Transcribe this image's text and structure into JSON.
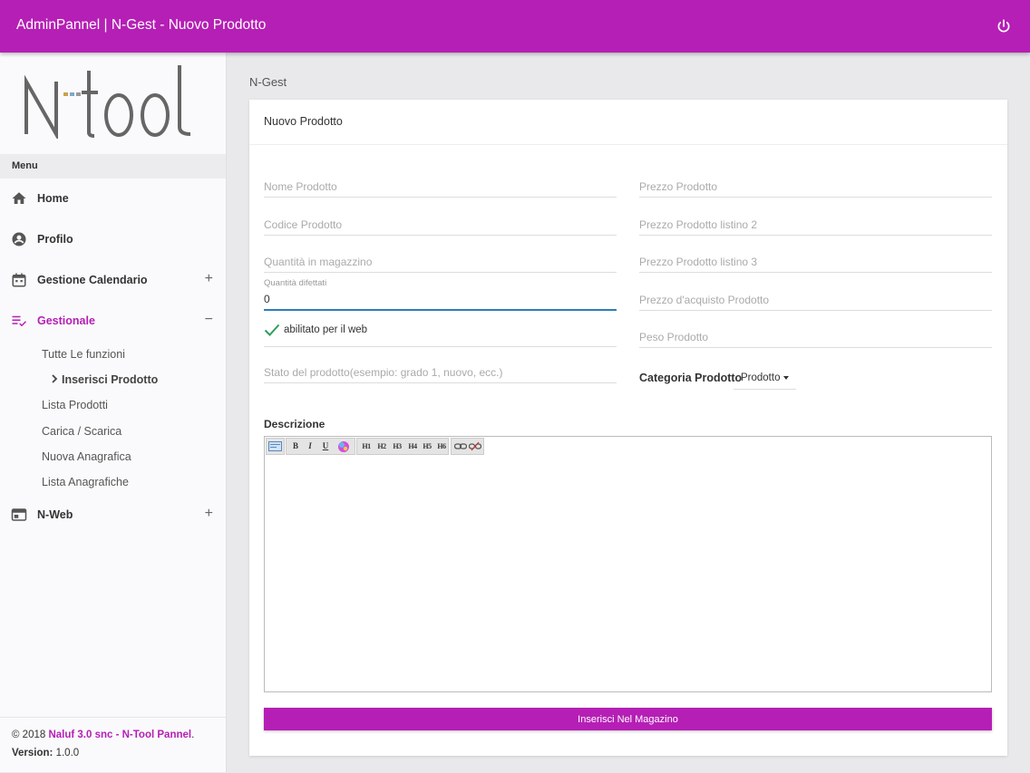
{
  "header": {
    "title": "AdminPannel | N-Gest - Nuovo Prodotto"
  },
  "sidebar": {
    "logo": "N·tool",
    "menu_label": "Menu",
    "items": [
      {
        "label": "Home",
        "icon": "home-icon"
      },
      {
        "label": "Profilo",
        "icon": "account-circle-icon"
      },
      {
        "label": "Gestione Calendario",
        "icon": "calendar-icon",
        "toggle": "+"
      },
      {
        "label": "Gestionale",
        "icon": "playlist-check-icon",
        "toggle": "−"
      },
      {
        "label": "N-Web",
        "icon": "web-window-icon",
        "toggle": "+"
      }
    ],
    "subitems": [
      "Tutte Le funzioni",
      "Inserisci Prodotto",
      "Lista Prodotti",
      "Carica / Scarica",
      "Nuova Anagrafica",
      "Lista Anagrafiche"
    ]
  },
  "footer": {
    "copyright": "© 2018",
    "brand": "Naluf 3.0 snc - N-Tool Pannel",
    "period": ".",
    "version_label": "Version:",
    "version": "1.0.0"
  },
  "breadcrumb": "N-Gest",
  "card": {
    "title": "Nuovo Prodotto"
  },
  "form": {
    "nome_placeholder": "Nome Prodotto",
    "codice_placeholder": "Codice Prodotto",
    "quantita_placeholder": "Quantità in magazzino",
    "difettati_label": "Quantità difettati",
    "difettati_value": "0",
    "web_label": "abilitato per il web",
    "stato_placeholder": "Stato del prodotto(esempio: grado 1, nuovo, ecc.)",
    "prezzo_placeholder": "Prezzo Prodotto",
    "prezzo2_placeholder": "Prezzo Prodotto listino 2",
    "prezzo3_placeholder": "Prezzo Prodotto listino 3",
    "acquisto_placeholder": "Prezzo d'acquisto Prodotto",
    "peso_placeholder": "Peso Prodotto",
    "categoria_label": "Categoria Prodotto",
    "categoria_value": "Prodotto",
    "descrizione_label": "Descrizione"
  },
  "editor": {
    "buttons": [
      "B",
      "I",
      "U"
    ],
    "headings": [
      "H1",
      "H2",
      "H3",
      "H4",
      "H5",
      "H6"
    ]
  },
  "submit_label": "Inserisci Nel Magazino",
  "colors": {
    "accent": "#b51fb5",
    "focus": "#2d7fb8",
    "check": "#2e9e5b"
  }
}
